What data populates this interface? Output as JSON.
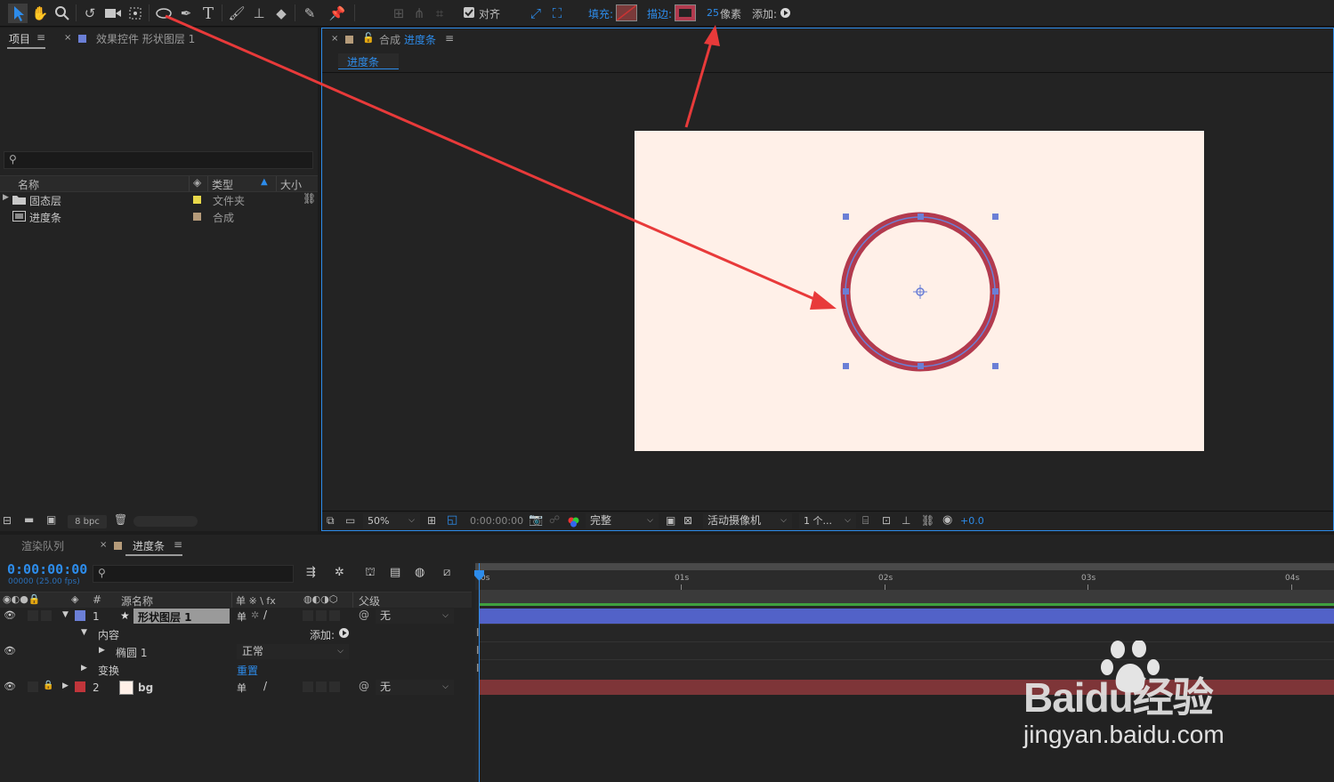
{
  "toolbar": {
    "snap_label": "对齐",
    "fill_label": "填充:",
    "stroke_label": "描边:",
    "stroke_width": "25",
    "stroke_unit": "像素",
    "add_label": "添加:",
    "fill_color": "#7a3a3a",
    "stroke_color": "#b23a4e"
  },
  "project_panel": {
    "tab_project": "项目",
    "tab_effects": "效果控件 形状图层 1",
    "search_placeholder": "",
    "columns": {
      "name": "名称",
      "type": "类型",
      "size": "大小"
    },
    "items": [
      {
        "name": "固态层",
        "type": "文件夹",
        "color": "#e8d84a"
      },
      {
        "name": "进度条",
        "type": "合成",
        "color": "#b59b7a"
      }
    ],
    "bpc": "8 bpc"
  },
  "comp_panel": {
    "tab_prefix": "合成",
    "tab_name": "进度条",
    "breadcrumb": "进度条",
    "canvas_color": "#fff0e8",
    "circle_color": "#b23a4e",
    "path_color": "#6b7fd6"
  },
  "viewer_bar": {
    "zoom": "50%",
    "timecode": "0:00:00:00",
    "resolution": "完整",
    "camera": "活动摄像机",
    "views": "1 个...",
    "exposure": "+0.0"
  },
  "timeline": {
    "tab_render_queue": "渲染队列",
    "tab_comp": "进度条",
    "timecode": "0:00:00:00",
    "frame_info": "00000 (25.00 fps)",
    "columns": {
      "num": "#",
      "source": "源名称",
      "switches": "单 ※ \\ fx",
      "parent": "父级"
    },
    "layers": [
      {
        "num": "1",
        "name": "形状图层 1",
        "color": "#6b7fd6",
        "parent": "无",
        "selected": true
      },
      {
        "num": "2",
        "name": "bg",
        "color": "#c0353b",
        "parent": "无",
        "selected": false
      }
    ],
    "contents_label": "内容",
    "add_label": "添加:",
    "ellipse_label": "椭圆 1",
    "blend_mode": "正常",
    "transform_label": "变换",
    "reset_label": "重置",
    "ruler": [
      "0s",
      "01s",
      "02s",
      "03s",
      "04s"
    ],
    "bar_colors": {
      "layer1": "#5262c8",
      "layer2": "#7e3538",
      "work": "#3fa03f"
    }
  },
  "watermark": {
    "brand": "Baidu经验",
    "url": "jingyan.baidu.com"
  }
}
